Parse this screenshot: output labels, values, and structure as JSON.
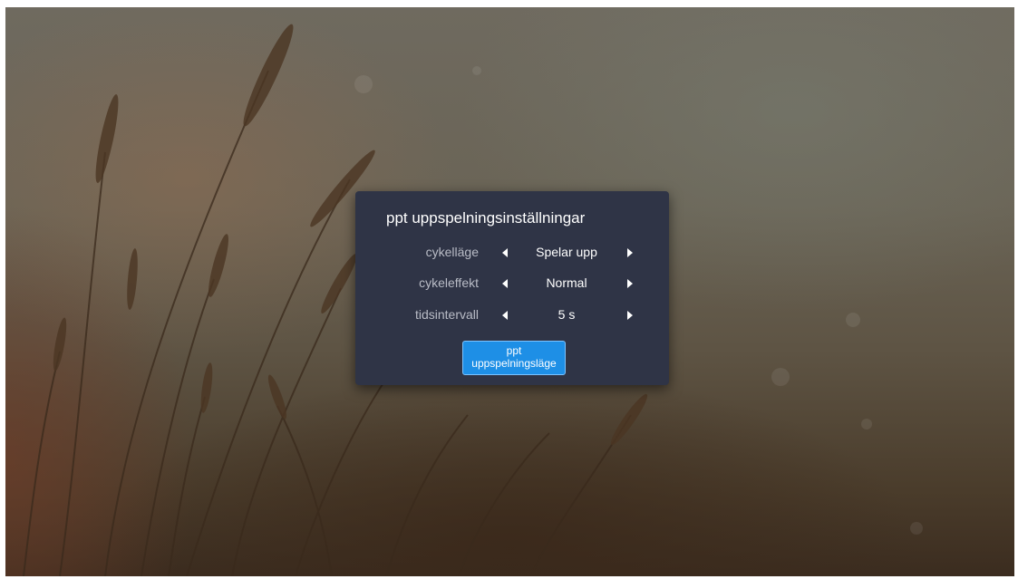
{
  "dialog": {
    "title": "ppt uppspelningsinställningar",
    "rows": [
      {
        "label": "cykelläge",
        "value": "Spelar upp",
        "left_icon": "arrow-left-icon",
        "right_icon": "arrow-right-icon"
      },
      {
        "label": "cykeleffekt",
        "value": "Normal",
        "left_icon": "arrow-left-icon",
        "right_icon": "arrow-right-icon"
      },
      {
        "label": "tidsintervall",
        "value": "5 s",
        "left_icon": "arrow-left-icon",
        "right_icon": "arrow-right-icon"
      }
    ],
    "button_label_line1": "ppt",
    "button_label_line2": "uppspelningsläge"
  },
  "colors": {
    "dialog_background": "#2f3446",
    "button_accent": "#1e8fe6",
    "label_text": "#b9bcc6"
  }
}
